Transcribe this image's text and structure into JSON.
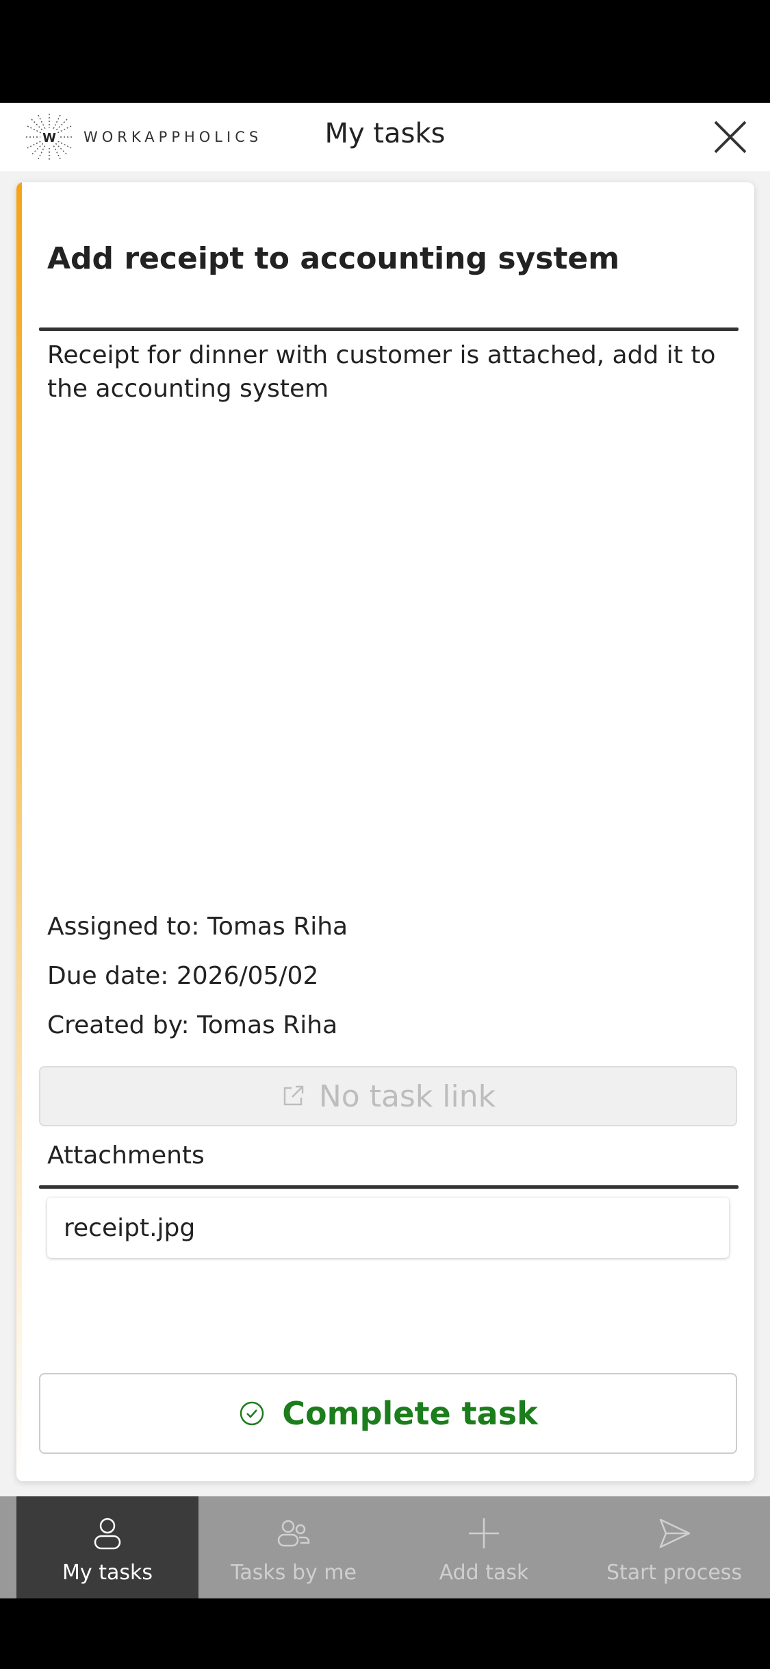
{
  "header": {
    "logo_letter": "W",
    "logo_text": "WORKAPPHOLICS",
    "title": "My tasks"
  },
  "task": {
    "title": "Add receipt to accounting system",
    "description": "Receipt for dinner with customer is attached, add it to the accounting system",
    "assigned_to": "Assigned to: Tomas Riha",
    "due_date": "Due date: 2026/05/02",
    "created_by": "Created by: Tomas Riha",
    "task_link_label": "No task link",
    "attachments_label": "Attachments",
    "attachments": [
      "receipt.jpg"
    ],
    "complete_label": "Complete task"
  },
  "tabs": [
    {
      "label": "My tasks",
      "icon": "person-icon",
      "active": true
    },
    {
      "label": "Tasks by me",
      "icon": "people-icon",
      "active": false
    },
    {
      "label": "Add task",
      "icon": "plus-icon",
      "active": false
    },
    {
      "label": "Start process",
      "icon": "send-icon",
      "active": false
    }
  ],
  "colors": {
    "accent": "#f5a417",
    "complete": "#1b7d1b",
    "tab_active": "#3b3b3b",
    "tab_bg": "#999999"
  }
}
